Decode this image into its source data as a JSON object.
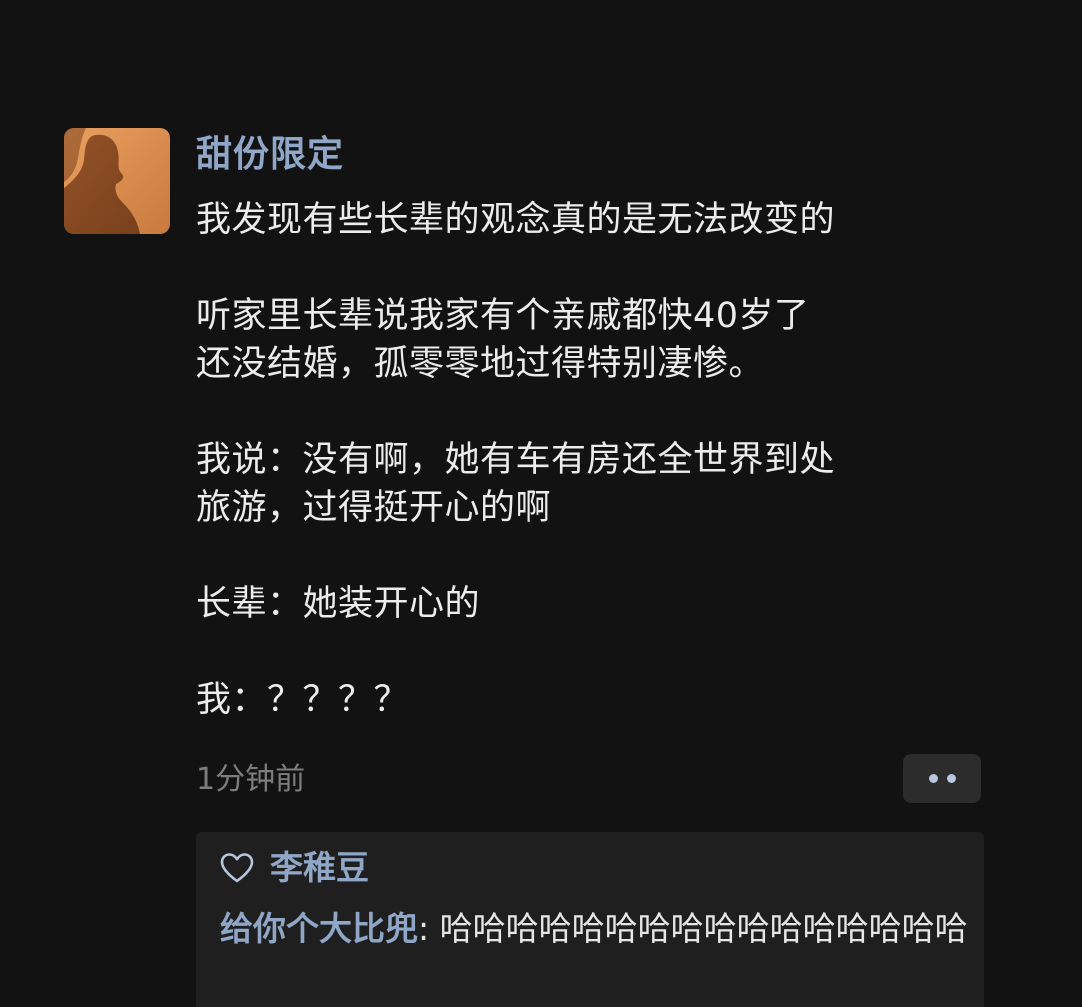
{
  "post": {
    "author": "甜份限定",
    "avatar_icon": "silhouette-avatar",
    "text": "我发现有些长辈的观念真的是无法改变的\n\n听家里长辈说我家有个亲戚都快40岁了\n还没结婚，孤零零地过得特别凄惨。\n\n我说：没有啊，她有车有房还全世界到处\n旅游，过得挺开心的啊\n\n长辈：她装开心的\n\n我：？？？？",
    "timestamp": "1分钟前"
  },
  "actions": {
    "more_icon": "more-dots-icon"
  },
  "likes": {
    "icon": "heart-icon",
    "names": "李稚豆"
  },
  "comments": [
    {
      "author": "给你个大比兜",
      "separator": ": ",
      "text": "哈哈哈哈哈哈哈哈哈哈哈哈哈哈哈哈"
    }
  ],
  "colors": {
    "background": "#121212",
    "name_link": "#8fa6c7",
    "text": "#ececec",
    "muted": "#7d7d7d",
    "panel": "#1f1f1f"
  }
}
